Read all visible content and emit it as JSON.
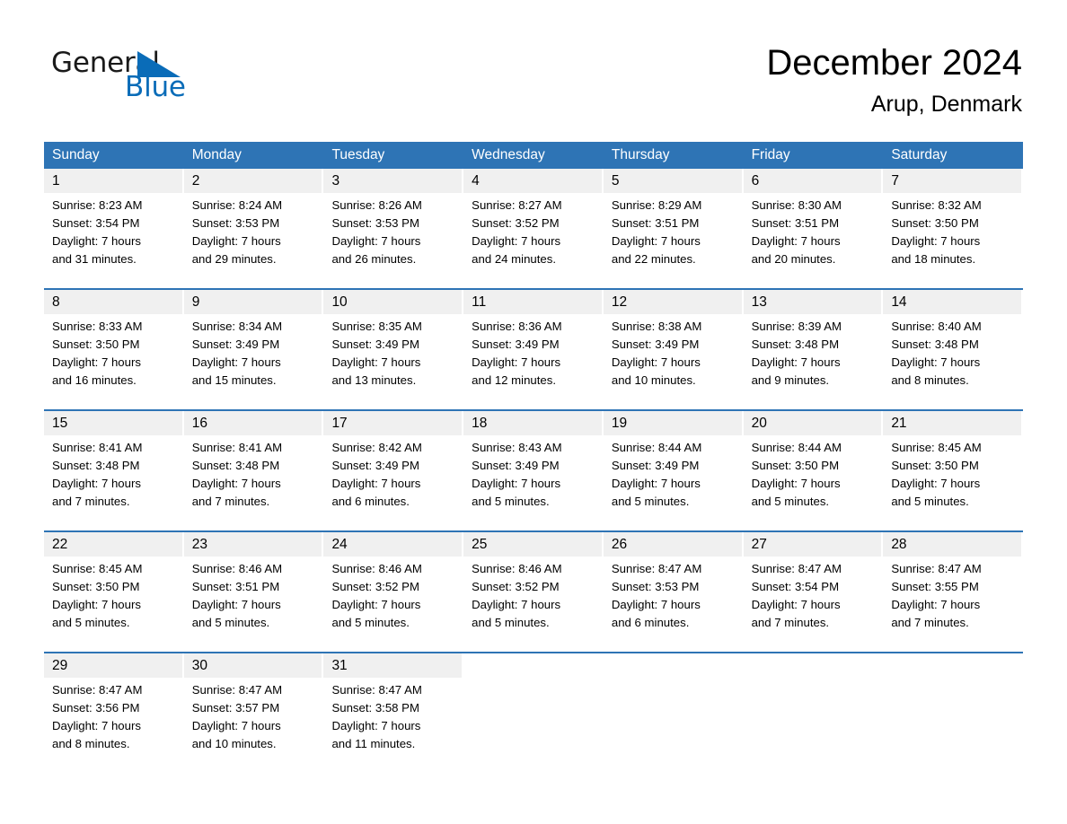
{
  "brand": {
    "name_part1": "General",
    "name_part2": "Blue",
    "triangle_color": "#0a6cb8",
    "accent_color": "#2e74b5"
  },
  "header": {
    "title": "December 2024",
    "subtitle": "Arup, Denmark"
  },
  "calendar": {
    "weekdays": [
      "Sunday",
      "Monday",
      "Tuesday",
      "Wednesday",
      "Thursday",
      "Friday",
      "Saturday"
    ],
    "header_bg": "#2e74b5",
    "daynum_bg": "#f0f0f0",
    "weeks": [
      [
        {
          "day": "1",
          "sunrise": "Sunrise: 8:23 AM",
          "sunset": "Sunset: 3:54 PM",
          "daylight_1": "Daylight: 7 hours",
          "daylight_2": "and 31 minutes."
        },
        {
          "day": "2",
          "sunrise": "Sunrise: 8:24 AM",
          "sunset": "Sunset: 3:53 PM",
          "daylight_1": "Daylight: 7 hours",
          "daylight_2": "and 29 minutes."
        },
        {
          "day": "3",
          "sunrise": "Sunrise: 8:26 AM",
          "sunset": "Sunset: 3:53 PM",
          "daylight_1": "Daylight: 7 hours",
          "daylight_2": "and 26 minutes."
        },
        {
          "day": "4",
          "sunrise": "Sunrise: 8:27 AM",
          "sunset": "Sunset: 3:52 PM",
          "daylight_1": "Daylight: 7 hours",
          "daylight_2": "and 24 minutes."
        },
        {
          "day": "5",
          "sunrise": "Sunrise: 8:29 AM",
          "sunset": "Sunset: 3:51 PM",
          "daylight_1": "Daylight: 7 hours",
          "daylight_2": "and 22 minutes."
        },
        {
          "day": "6",
          "sunrise": "Sunrise: 8:30 AM",
          "sunset": "Sunset: 3:51 PM",
          "daylight_1": "Daylight: 7 hours",
          "daylight_2": "and 20 minutes."
        },
        {
          "day": "7",
          "sunrise": "Sunrise: 8:32 AM",
          "sunset": "Sunset: 3:50 PM",
          "daylight_1": "Daylight: 7 hours",
          "daylight_2": "and 18 minutes."
        }
      ],
      [
        {
          "day": "8",
          "sunrise": "Sunrise: 8:33 AM",
          "sunset": "Sunset: 3:50 PM",
          "daylight_1": "Daylight: 7 hours",
          "daylight_2": "and 16 minutes."
        },
        {
          "day": "9",
          "sunrise": "Sunrise: 8:34 AM",
          "sunset": "Sunset: 3:49 PM",
          "daylight_1": "Daylight: 7 hours",
          "daylight_2": "and 15 minutes."
        },
        {
          "day": "10",
          "sunrise": "Sunrise: 8:35 AM",
          "sunset": "Sunset: 3:49 PM",
          "daylight_1": "Daylight: 7 hours",
          "daylight_2": "and 13 minutes."
        },
        {
          "day": "11",
          "sunrise": "Sunrise: 8:36 AM",
          "sunset": "Sunset: 3:49 PM",
          "daylight_1": "Daylight: 7 hours",
          "daylight_2": "and 12 minutes."
        },
        {
          "day": "12",
          "sunrise": "Sunrise: 8:38 AM",
          "sunset": "Sunset: 3:49 PM",
          "daylight_1": "Daylight: 7 hours",
          "daylight_2": "and 10 minutes."
        },
        {
          "day": "13",
          "sunrise": "Sunrise: 8:39 AM",
          "sunset": "Sunset: 3:48 PM",
          "daylight_1": "Daylight: 7 hours",
          "daylight_2": "and 9 minutes."
        },
        {
          "day": "14",
          "sunrise": "Sunrise: 8:40 AM",
          "sunset": "Sunset: 3:48 PM",
          "daylight_1": "Daylight: 7 hours",
          "daylight_2": "and 8 minutes."
        }
      ],
      [
        {
          "day": "15",
          "sunrise": "Sunrise: 8:41 AM",
          "sunset": "Sunset: 3:48 PM",
          "daylight_1": "Daylight: 7 hours",
          "daylight_2": "and 7 minutes."
        },
        {
          "day": "16",
          "sunrise": "Sunrise: 8:41 AM",
          "sunset": "Sunset: 3:48 PM",
          "daylight_1": "Daylight: 7 hours",
          "daylight_2": "and 7 minutes."
        },
        {
          "day": "17",
          "sunrise": "Sunrise: 8:42 AM",
          "sunset": "Sunset: 3:49 PM",
          "daylight_1": "Daylight: 7 hours",
          "daylight_2": "and 6 minutes."
        },
        {
          "day": "18",
          "sunrise": "Sunrise: 8:43 AM",
          "sunset": "Sunset: 3:49 PM",
          "daylight_1": "Daylight: 7 hours",
          "daylight_2": "and 5 minutes."
        },
        {
          "day": "19",
          "sunrise": "Sunrise: 8:44 AM",
          "sunset": "Sunset: 3:49 PM",
          "daylight_1": "Daylight: 7 hours",
          "daylight_2": "and 5 minutes."
        },
        {
          "day": "20",
          "sunrise": "Sunrise: 8:44 AM",
          "sunset": "Sunset: 3:50 PM",
          "daylight_1": "Daylight: 7 hours",
          "daylight_2": "and 5 minutes."
        },
        {
          "day": "21",
          "sunrise": "Sunrise: 8:45 AM",
          "sunset": "Sunset: 3:50 PM",
          "daylight_1": "Daylight: 7 hours",
          "daylight_2": "and 5 minutes."
        }
      ],
      [
        {
          "day": "22",
          "sunrise": "Sunrise: 8:45 AM",
          "sunset": "Sunset: 3:50 PM",
          "daylight_1": "Daylight: 7 hours",
          "daylight_2": "and 5 minutes."
        },
        {
          "day": "23",
          "sunrise": "Sunrise: 8:46 AM",
          "sunset": "Sunset: 3:51 PM",
          "daylight_1": "Daylight: 7 hours",
          "daylight_2": "and 5 minutes."
        },
        {
          "day": "24",
          "sunrise": "Sunrise: 8:46 AM",
          "sunset": "Sunset: 3:52 PM",
          "daylight_1": "Daylight: 7 hours",
          "daylight_2": "and 5 minutes."
        },
        {
          "day": "25",
          "sunrise": "Sunrise: 8:46 AM",
          "sunset": "Sunset: 3:52 PM",
          "daylight_1": "Daylight: 7 hours",
          "daylight_2": "and 5 minutes."
        },
        {
          "day": "26",
          "sunrise": "Sunrise: 8:47 AM",
          "sunset": "Sunset: 3:53 PM",
          "daylight_1": "Daylight: 7 hours",
          "daylight_2": "and 6 minutes."
        },
        {
          "day": "27",
          "sunrise": "Sunrise: 8:47 AM",
          "sunset": "Sunset: 3:54 PM",
          "daylight_1": "Daylight: 7 hours",
          "daylight_2": "and 7 minutes."
        },
        {
          "day": "28",
          "sunrise": "Sunrise: 8:47 AM",
          "sunset": "Sunset: 3:55 PM",
          "daylight_1": "Daylight: 7 hours",
          "daylight_2": "and 7 minutes."
        }
      ],
      [
        {
          "day": "29",
          "sunrise": "Sunrise: 8:47 AM",
          "sunset": "Sunset: 3:56 PM",
          "daylight_1": "Daylight: 7 hours",
          "daylight_2": "and 8 minutes."
        },
        {
          "day": "30",
          "sunrise": "Sunrise: 8:47 AM",
          "sunset": "Sunset: 3:57 PM",
          "daylight_1": "Daylight: 7 hours",
          "daylight_2": "and 10 minutes."
        },
        {
          "day": "31",
          "sunrise": "Sunrise: 8:47 AM",
          "sunset": "Sunset: 3:58 PM",
          "daylight_1": "Daylight: 7 hours",
          "daylight_2": "and 11 minutes."
        },
        {
          "day": "",
          "sunrise": "",
          "sunset": "",
          "daylight_1": "",
          "daylight_2": ""
        },
        {
          "day": "",
          "sunrise": "",
          "sunset": "",
          "daylight_1": "",
          "daylight_2": ""
        },
        {
          "day": "",
          "sunrise": "",
          "sunset": "",
          "daylight_1": "",
          "daylight_2": ""
        },
        {
          "day": "",
          "sunrise": "",
          "sunset": "",
          "daylight_1": "",
          "daylight_2": ""
        }
      ]
    ]
  }
}
